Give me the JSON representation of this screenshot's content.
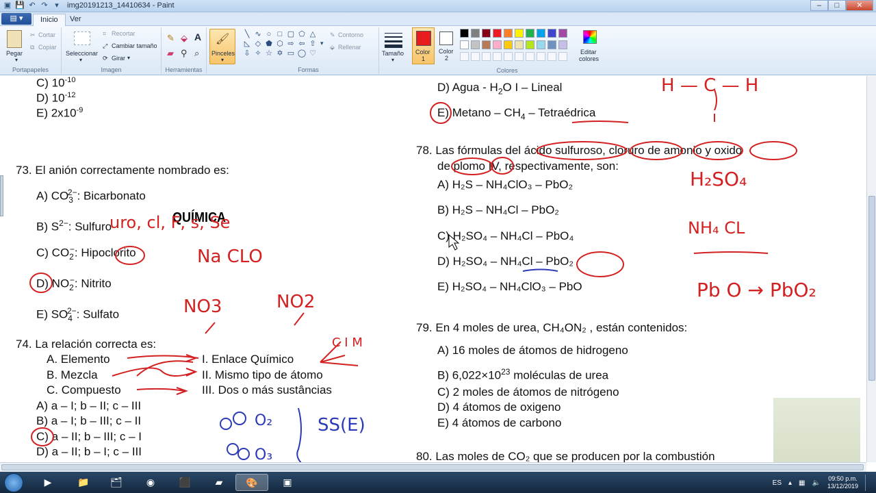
{
  "window": {
    "title": "img20191213_14410634 - Paint",
    "controls": {
      "minimize": "–",
      "maximize": "□",
      "close": "✕"
    }
  },
  "tabs": [
    {
      "label": "Inicio"
    },
    {
      "label": "Ver"
    }
  ],
  "ribbon": {
    "clipboard": {
      "paste": "Pegar",
      "cut": "Cortar",
      "copy": "Copiar",
      "group": "Portapapeles"
    },
    "image": {
      "select": "Seleccionar",
      "crop": "Recortar",
      "resize": "Cambiar tamaño",
      "rotate": "Girar",
      "group": "Imagen"
    },
    "tools": {
      "group": "Herramientas"
    },
    "brushes": {
      "label": "Pinceles"
    },
    "shapes": {
      "outline": "Contorno",
      "fill": "Rellenar",
      "group": "Formas"
    },
    "size": {
      "label": "Tamaño"
    },
    "color1": {
      "label": "Color",
      "num": "1",
      "value": "#e81c1c"
    },
    "color2": {
      "label": "Color",
      "num": "2",
      "value": "#ffffff"
    },
    "edit_colors": {
      "label1": "Editar",
      "label2": "colores"
    },
    "colors_group": "Colores",
    "palette": [
      "#000000",
      "#7f7f7f",
      "#880015",
      "#ed1c24",
      "#ff7f27",
      "#fff200",
      "#22b14c",
      "#00a2e8",
      "#3f48cc",
      "#a349a4",
      "#ffffff",
      "#c3c3c3",
      "#b97a57",
      "#ffaec9",
      "#ffc90e",
      "#efe4b0",
      "#b5e61d",
      "#99d9ea",
      "#7092be",
      "#c8bfe7"
    ]
  },
  "doc": {
    "left": {
      "ansC": "C) 10",
      "ansC_exp": "-10",
      "ansD": "D) 10",
      "ansD_exp": "-12",
      "ansE": "E) 2x10",
      "ansE_exp": "-9",
      "heading": "QUÍMICA",
      "q73": "73. El anión correctamente nombrado es:",
      "q73a": "A)  CO",
      "q73a_sub": "3",
      "q73a_sup": "2−",
      "q73a_rest": ": Bicarbonato",
      "q73b": "B)  S",
      "q73b_sup": "2−",
      "q73b_rest": ": Sulfuro",
      "q73c": "C)  CO",
      "q73c_sub": "2",
      "q73c_sup": "−",
      "q73c_rest": ": Hipoclorito",
      "q73d": "D) NO",
      "q73d_sub": "2",
      "q73d_sup": "−",
      "q73d_rest": ": Nitrito",
      "q73e": "E)  SO",
      "q73e_sub": "4",
      "q73e_sup": "2−",
      "q73e_rest": ": Sulfato",
      "q74": "74. La relación correcta es:",
      "q74_A": "A.   Elemento",
      "q74_B": "B.   Mezcla",
      "q74_C": "C.   Compuesto",
      "q74_I": "I.     Enlace Químico",
      "q74_II": "II.   Mismo tipo de átomo",
      "q74_III": "III.  Dos o más sustâncias",
      "q74a": "A) a – I; b – II; c – III",
      "q74b": "B) a – I; b – III; c – II",
      "q74c": "C) a – II; b – III; c – I",
      "q74d": "D) a – II; b – I; c – III"
    },
    "right": {
      "d_prev": "D) Agua  -  H",
      "d_prev_sub": "2",
      "d_prev_rest": "O I – Lineal",
      "e_prev": "E) Metano  –  CH",
      "e_prev_sub": "4",
      "e_prev_rest": " – Tetraédrica",
      "q78_l1": "78. Las fórmulas del ácido sulfuroso, cloruro de amonio y oxido",
      "q78_l2": "de plomo IV, respectivamente, son:",
      "q78a": "A)  H₂S  –  NH₄ClO₃  –  PbO₂",
      "q78b": "B)  H₂S  –  NH₄Cl  –  PbO₂",
      "q78c": "C)  H₂SO₄  –  NH₄Cl  –  PbO₄",
      "q78d": "D)  H₂SO₄  –  NH₄Cl  –  PbO₂",
      "q78e": "E)  H₂SO₄  –  NH₄ClO₃ – PbO",
      "q79": "79. En 4 moles de urea,  CH₄ON₂ , están contenidos:",
      "q79a": "A) 16 moles de átomos de hidrogeno",
      "q79b": "B)  6,022×10",
      "q79b_sup": "23",
      "q79b_rest": "  moléculas de urea",
      "q79c": "C) 2 moles de átomos de nitrógeno",
      "q79d": "D) 4 átomos de oxigeno",
      "q79e": "E) 4 átomos de carbono",
      "q80": "80. Las moles de  CO₂  que se producen por la combustión"
    }
  },
  "annotations": {
    "uro": "uro, cl, F, s, Se",
    "naclo": "Na CLO",
    "no3": "NO3",
    "no2": "NO2",
    "hso4": "H₂SO₄",
    "nh4cl": "NH₄ CL",
    "pbo2": "Pb O → PbO₂",
    "hch": "H — C — H",
    "ss": "SS(E)",
    "o2": "O₂",
    "o3": "O₃",
    "cim": "C I M"
  },
  "taskbar": {
    "language": "ES",
    "time": "09:50 p.m.",
    "date": "13/12/2019"
  }
}
